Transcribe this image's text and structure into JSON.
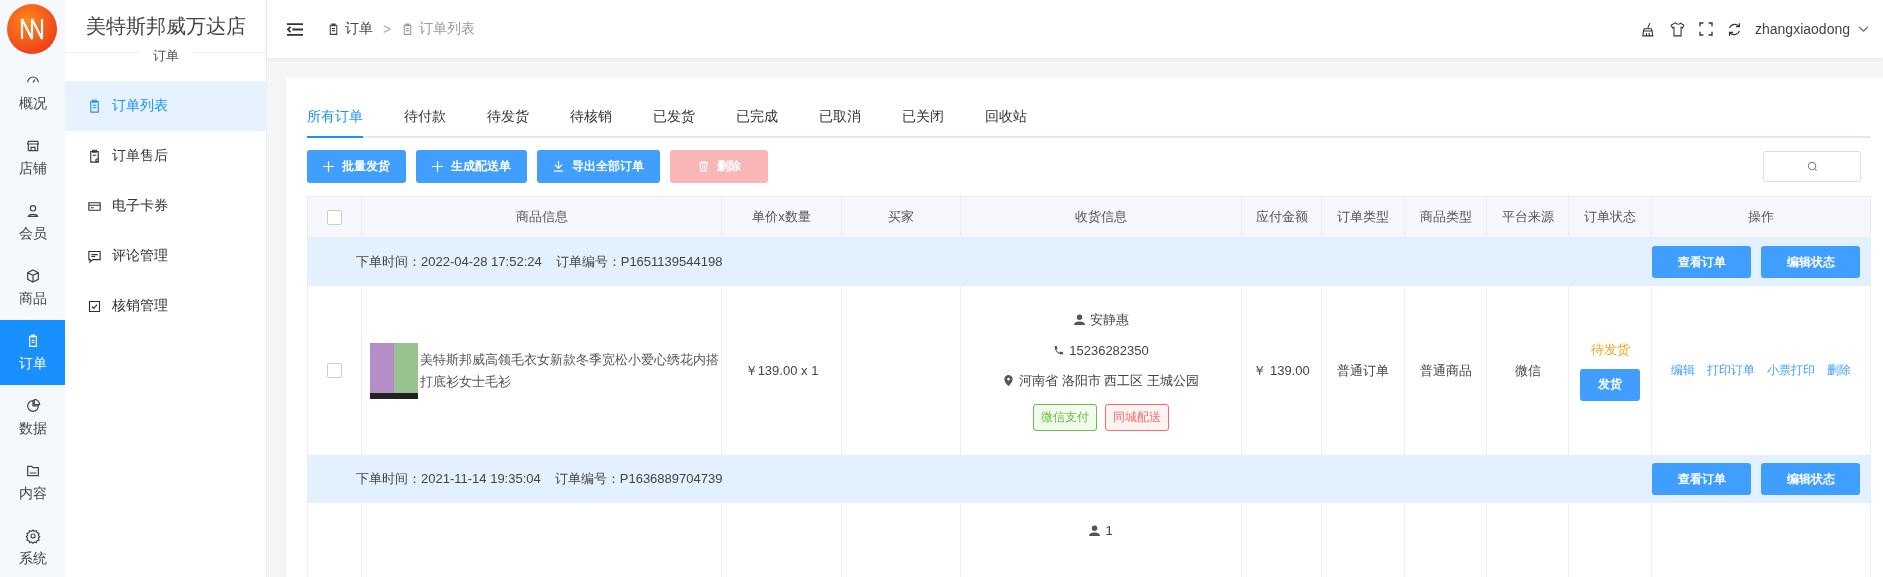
{
  "shop": {
    "name": "美特斯邦威万达店"
  },
  "rail": [
    {
      "label": "概况",
      "selected": false
    },
    {
      "label": "店铺",
      "selected": false
    },
    {
      "label": "会员",
      "selected": false
    },
    {
      "label": "商品",
      "selected": false
    },
    {
      "label": "订单",
      "selected": true
    },
    {
      "label": "数据",
      "selected": false
    },
    {
      "label": "内容",
      "selected": false
    },
    {
      "label": "系统",
      "selected": false
    }
  ],
  "submenu": {
    "title": "订单",
    "items": [
      {
        "label": "订单列表",
        "selected": true
      },
      {
        "label": "订单售后",
        "selected": false
      },
      {
        "label": "电子卡券",
        "selected": false
      },
      {
        "label": "评论管理",
        "selected": false
      },
      {
        "label": "核销管理",
        "selected": false
      }
    ]
  },
  "breadcrumb": {
    "items": [
      "订单",
      "订单列表"
    ],
    "separator": ">"
  },
  "user": {
    "name": "zhangxiaodong"
  },
  "tabs": [
    {
      "label": "所有订单",
      "selected": true
    },
    {
      "label": "待付款",
      "selected": false
    },
    {
      "label": "待发货",
      "selected": false
    },
    {
      "label": "待核销",
      "selected": false
    },
    {
      "label": "已发货",
      "selected": false
    },
    {
      "label": "已完成",
      "selected": false
    },
    {
      "label": "已取消",
      "selected": false
    },
    {
      "label": "已关闭",
      "selected": false
    },
    {
      "label": "回收站",
      "selected": false
    }
  ],
  "actions": [
    {
      "label": "批量发货",
      "kind": "add",
      "disabled": false
    },
    {
      "label": "生成配送单",
      "kind": "add",
      "disabled": false
    },
    {
      "label": "导出全部订单",
      "kind": "export",
      "disabled": false
    },
    {
      "label": "删除",
      "kind": "delete",
      "disabled": true
    }
  ],
  "table": {
    "all_checked": false,
    "columns": [
      "商品信息",
      "单价x数量",
      "买家",
      "收货信息",
      "应付金额",
      "订单类型",
      "商品类型",
      "平台来源",
      "订单状态",
      "操作"
    ],
    "orders": [
      {
        "time_label": "下单时间：",
        "time": "2022-04-28 17:52:24",
        "number_label": "订单编号：",
        "number": "P1651139544198",
        "header_buttons": [
          "查看订单",
          "编辑状态"
        ],
        "checked": false,
        "product": "美特斯邦威高领毛衣女新款冬季宽松小爱心绣花内搭打底衫女士毛衫",
        "price": "￥139.00 x 1",
        "receiver": {
          "name": "安静惠",
          "phone": "15236282350",
          "address": "河南省 洛阳市 西工区 王城公园"
        },
        "tags": [
          {
            "label": "微信支付",
            "color": "#67c23a"
          },
          {
            "label": "同城配送",
            "color": "#f56c6c"
          }
        ],
        "amount": "￥ 139.00",
        "order_type": "普通订单",
        "goods_type": "普通商品",
        "platform": "微信",
        "status": "待发货",
        "status_button": "发货",
        "operations": [
          "编辑",
          "打印订单",
          "小票打印",
          "删除"
        ]
      },
      {
        "time_label": "下单时间：",
        "time": "2021-11-14 19:35:04",
        "number_label": "订单编号：",
        "number": "P1636889704739",
        "header_buttons": [
          "查看订单",
          "编辑状态"
        ],
        "receiver": {
          "name": "1"
        }
      }
    ]
  }
}
